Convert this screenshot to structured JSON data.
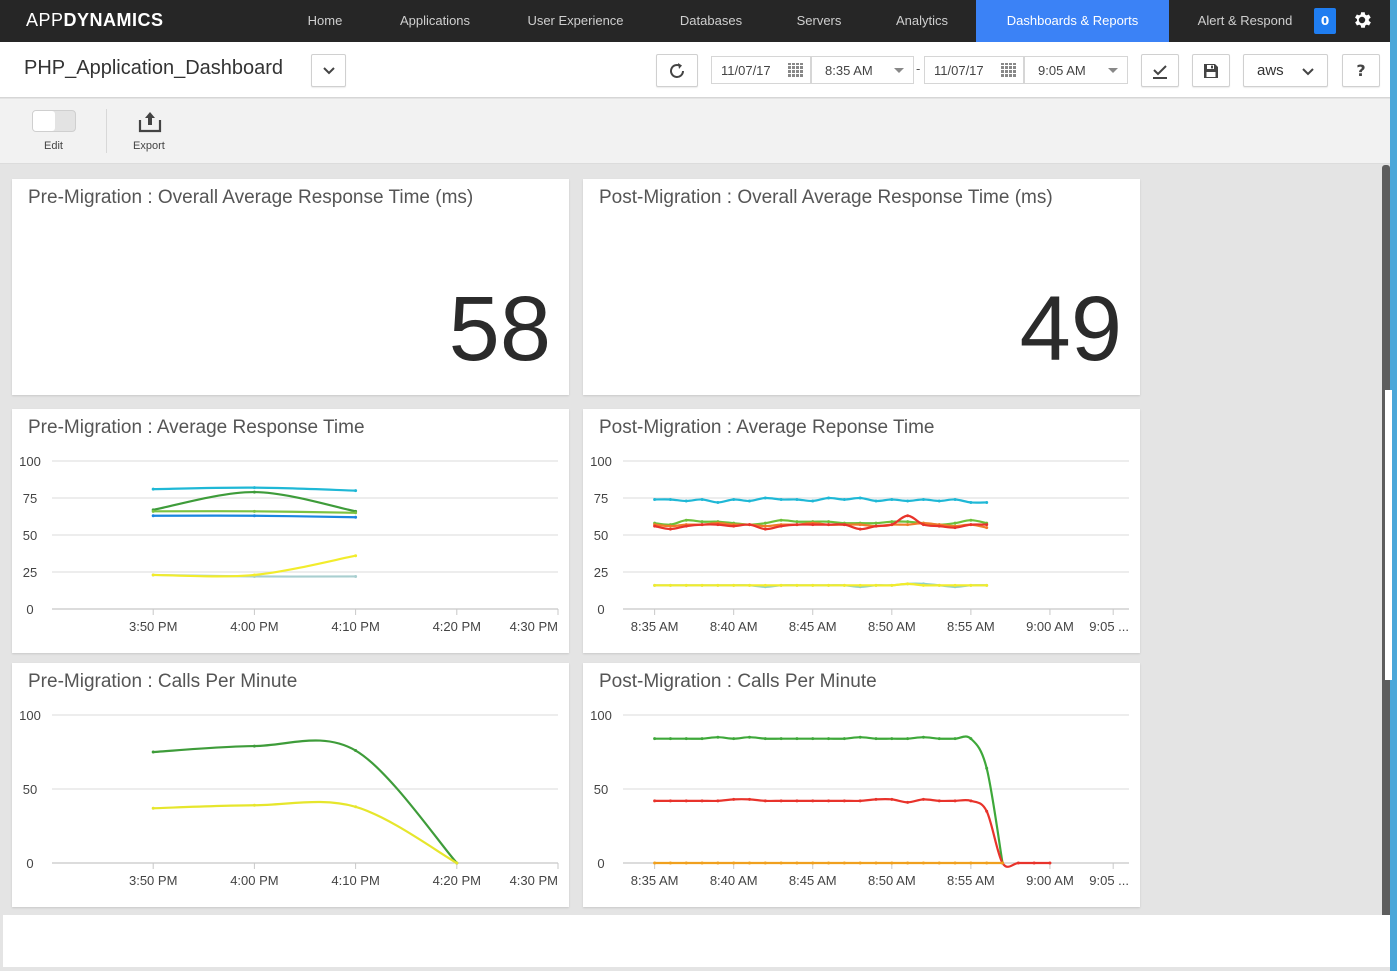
{
  "nav": {
    "logo_thin": "APP",
    "logo_bold": "DYNAMICS",
    "items": [
      {
        "label": "Home"
      },
      {
        "label": "Applications"
      },
      {
        "label": "User Experience"
      },
      {
        "label": "Databases"
      },
      {
        "label": "Servers"
      },
      {
        "label": "Analytics"
      },
      {
        "label": "Dashboards & Reports",
        "active": true
      },
      {
        "label": "Alert & Respond"
      }
    ],
    "alert_count": "0",
    "accent_color": "#3b82f6"
  },
  "header": {
    "title": "PHP_Application_Dashboard",
    "start_date": "11/07/17",
    "start_time": "8:35 AM",
    "range_separator": "-",
    "end_date": "11/07/17",
    "end_time": "9:05 AM",
    "environment": "aws",
    "help": "?"
  },
  "toolbar": {
    "edit_label": "Edit",
    "export_label": "Export"
  },
  "widgets": {
    "pre_overall": {
      "title": "Pre-Migration : Overall Average Response Time (ms)",
      "value": "58"
    },
    "post_overall": {
      "title": "Post-Migration : Overall Average Response Time (ms)",
      "value": "49"
    },
    "pre_art": {
      "title": "Pre-Migration : Average Response Time"
    },
    "post_art": {
      "title": "Post-Migration : Average Reponse Time"
    },
    "pre_cpm": {
      "title": "Pre-Migration : Calls Per Minute"
    },
    "post_cpm": {
      "title": "Post-Migration : Calls Per Minute"
    }
  },
  "chart_data": [
    {
      "id": "pre_art",
      "type": "line",
      "title": "Pre-Migration : Average Response Time",
      "xlabel": "",
      "ylabel": "",
      "ylim": [
        0,
        100
      ],
      "yticks": [
        0,
        25,
        50,
        75,
        100
      ],
      "xlim": [
        0,
        50
      ],
      "xticks": [
        {
          "x": 10,
          "label": "3:50 PM"
        },
        {
          "x": 20,
          "label": "4:00 PM"
        },
        {
          "x": 30,
          "label": "4:10 PM"
        },
        {
          "x": 40,
          "label": "4:20 PM"
        },
        {
          "x": 50,
          "label": "4:30 PM"
        }
      ],
      "grid": true,
      "series": [
        {
          "name": "series-cyan",
          "color": "#1fb8d6",
          "x": [
            10,
            20,
            30
          ],
          "values": [
            81,
            82,
            80
          ]
        },
        {
          "name": "series-darkgreen",
          "color": "#3e9c3a",
          "x": [
            10,
            20,
            30
          ],
          "values": [
            67,
            79,
            66
          ]
        },
        {
          "name": "series-lightgreen",
          "color": "#7cc242",
          "x": [
            10,
            20,
            30
          ],
          "values": [
            66,
            66,
            65
          ]
        },
        {
          "name": "series-blue",
          "color": "#1a86e0",
          "x": [
            10,
            20,
            30
          ],
          "values": [
            63,
            63,
            62
          ]
        },
        {
          "name": "series-grey",
          "color": "#a9cfd0",
          "x": [
            10,
            20,
            30
          ],
          "values": [
            23,
            22,
            22
          ]
        },
        {
          "name": "series-yellow",
          "color": "#f2ec2c",
          "x": [
            10,
            20,
            30
          ],
          "values": [
            23,
            23,
            36
          ]
        }
      ]
    },
    {
      "id": "post_art",
      "type": "line",
      "title": "Post-Migration : Average Reponse Time",
      "xlabel": "",
      "ylabel": "",
      "ylim": [
        0,
        100
      ],
      "yticks": [
        0,
        25,
        50,
        75,
        100
      ],
      "xlim": [
        0,
        32
      ],
      "xticks": [
        {
          "x": 2,
          "label": "8:35 AM"
        },
        {
          "x": 7,
          "label": "8:40 AM"
        },
        {
          "x": 12,
          "label": "8:45 AM"
        },
        {
          "x": 17,
          "label": "8:50 AM"
        },
        {
          "x": 22,
          "label": "8:55 AM"
        },
        {
          "x": 27,
          "label": "9:00 AM"
        },
        {
          "x": 31,
          "label": "9:05 ..."
        }
      ],
      "grid": true,
      "series": [
        {
          "name": "series-cyan",
          "color": "#1fb8d6",
          "x0": 2,
          "values": [
            74,
            74,
            73,
            74,
            72,
            74,
            73,
            75,
            74,
            74,
            73,
            75,
            74,
            75,
            73,
            74,
            73,
            74,
            73,
            74,
            72,
            72
          ]
        },
        {
          "name": "series-green",
          "color": "#6cbf3a",
          "x0": 2,
          "values": [
            58,
            57,
            60,
            59,
            59,
            58,
            57,
            58,
            60,
            59,
            59,
            59,
            58,
            58,
            58,
            59,
            59,
            58,
            57,
            58,
            60,
            58
          ]
        },
        {
          "name": "series-orange",
          "color": "#f07b2a",
          "x0": 2,
          "values": [
            57,
            56,
            57,
            57,
            58,
            57,
            57,
            56,
            57,
            57,
            58,
            57,
            57,
            57,
            56,
            57,
            57,
            58,
            57,
            56,
            57,
            55
          ]
        },
        {
          "name": "series-red",
          "color": "#e8332b",
          "x0": 2,
          "values": [
            56,
            54,
            56,
            57,
            57,
            56,
            57,
            54,
            56,
            57,
            57,
            57,
            57,
            54,
            56,
            57,
            63,
            57,
            56,
            55,
            57,
            57
          ]
        },
        {
          "name": "series-teal",
          "color": "#8fd0c8",
          "x0": 2,
          "values": [
            16,
            16,
            16,
            16,
            16,
            16,
            16,
            15,
            16,
            16,
            16,
            16,
            16,
            15,
            16,
            16,
            17,
            17,
            16,
            15,
            16,
            16
          ]
        },
        {
          "name": "series-yellow",
          "color": "#f2ec2c",
          "x0": 2,
          "values": [
            16,
            16,
            16,
            16,
            16,
            16,
            16,
            16,
            16,
            16,
            16,
            16,
            16,
            16,
            16,
            16,
            17,
            16,
            16,
            16,
            16,
            16
          ]
        }
      ]
    },
    {
      "id": "pre_cpm",
      "type": "line",
      "title": "Pre-Migration : Calls Per Minute",
      "xlabel": "",
      "ylabel": "",
      "ylim": [
        0,
        100
      ],
      "yticks": [
        0,
        50,
        100
      ],
      "xlim": [
        0,
        50
      ],
      "xticks": [
        {
          "x": 10,
          "label": "3:50 PM"
        },
        {
          "x": 20,
          "label": "4:00 PM"
        },
        {
          "x": 30,
          "label": "4:10 PM"
        },
        {
          "x": 40,
          "label": "4:20 PM"
        },
        {
          "x": 50,
          "label": "4:30 PM"
        }
      ],
      "grid": true,
      "series": [
        {
          "name": "series-green",
          "color": "#3e9c3a",
          "x": [
            10,
            20,
            30,
            40
          ],
          "values": [
            75,
            79,
            76,
            0
          ]
        },
        {
          "name": "series-yellow",
          "color": "#e6e62c",
          "x": [
            10,
            20,
            30,
            40
          ],
          "values": [
            37,
            39,
            38,
            0
          ]
        }
      ]
    },
    {
      "id": "post_cpm",
      "type": "line",
      "title": "Post-Migration : Calls Per Minute",
      "xlabel": "",
      "ylabel": "",
      "ylim": [
        0,
        100
      ],
      "yticks": [
        0,
        50,
        100
      ],
      "xlim": [
        0,
        32
      ],
      "xticks": [
        {
          "x": 2,
          "label": "8:35 AM"
        },
        {
          "x": 7,
          "label": "8:40 AM"
        },
        {
          "x": 12,
          "label": "8:45 AM"
        },
        {
          "x": 17,
          "label": "8:50 AM"
        },
        {
          "x": 22,
          "label": "8:55 AM"
        },
        {
          "x": 27,
          "label": "9:00 AM"
        },
        {
          "x": 31,
          "label": "9:05 ..."
        }
      ],
      "grid": true,
      "series": [
        {
          "name": "series-green",
          "color": "#3ea83a",
          "x0": 2,
          "values": [
            84,
            84,
            84,
            84,
            85,
            84,
            85,
            84,
            84,
            84,
            84,
            84,
            84,
            85,
            84,
            84,
            84,
            85,
            84,
            84,
            84,
            64,
            0
          ]
        },
        {
          "name": "series-red",
          "color": "#e8332b",
          "x0": 2,
          "values": [
            42,
            42,
            42,
            42,
            42,
            43,
            43,
            42,
            42,
            42,
            42,
            42,
            42,
            42,
            43,
            43,
            41,
            43,
            42,
            42,
            42,
            35,
            0,
            0,
            0,
            0
          ]
        },
        {
          "name": "series-orange",
          "color": "#f0a01e",
          "x0": 2,
          "values": [
            0,
            0,
            0,
            0,
            0,
            0,
            0,
            0,
            0,
            0,
            0,
            0,
            0,
            0,
            0,
            0,
            0,
            0,
            0,
            0,
            0,
            0,
            0
          ]
        }
      ]
    }
  ]
}
